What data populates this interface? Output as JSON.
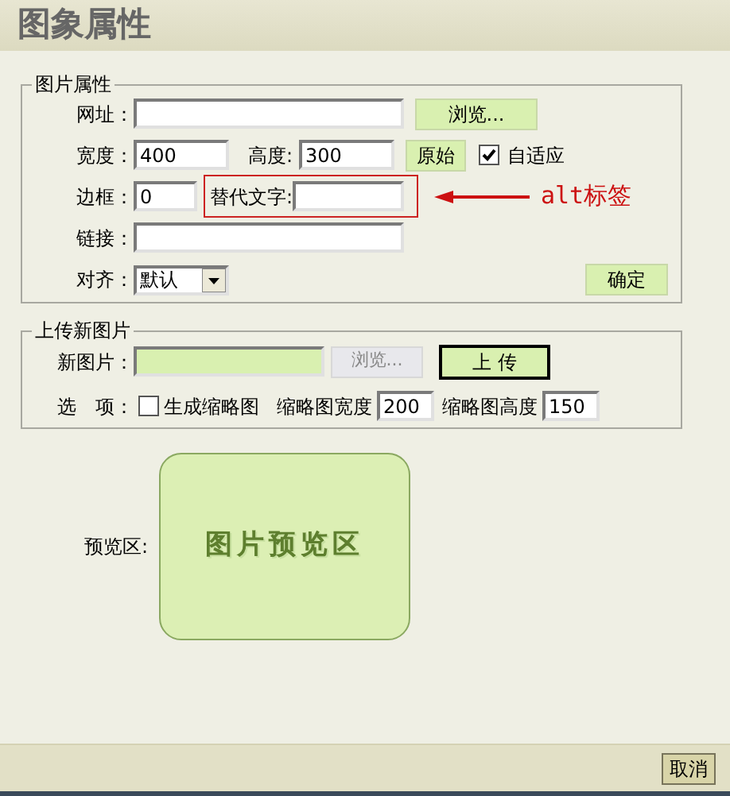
{
  "window": {
    "title": "图象属性"
  },
  "image_properties": {
    "legend": "图片属性",
    "url": {
      "label": "网址：",
      "browse_button": "浏览..."
    },
    "width": {
      "label": "宽度：",
      "value": "400"
    },
    "height": {
      "label": "高度:",
      "value": "300"
    },
    "original_button": "原始",
    "auto_fit": {
      "label": "自适应",
      "checked": true
    },
    "border": {
      "label": "边框：",
      "value": "0"
    },
    "alt_text": {
      "label": "替代文字:"
    },
    "link": {
      "label": "链接："
    },
    "align": {
      "label": "对齐：",
      "value": "默认"
    },
    "ok_button": "确定"
  },
  "annotation": {
    "text": "alt标签"
  },
  "upload": {
    "legend": "上传新图片",
    "new_image": {
      "label": "新图片："
    },
    "browse_button": {
      "label": "浏览...",
      "disabled": true
    },
    "upload_button": "上 传",
    "options_label": "选　项：",
    "thumbnail": {
      "label": "生成缩略图",
      "checked": false
    },
    "thumb_width": {
      "label": "缩略图宽度",
      "value": "200"
    },
    "thumb_height": {
      "label": "缩略图高度",
      "value": "150"
    }
  },
  "preview": {
    "label": "预览区:",
    "placeholder": "图片预览区"
  },
  "footer": {
    "cancel_button": "取消"
  }
}
